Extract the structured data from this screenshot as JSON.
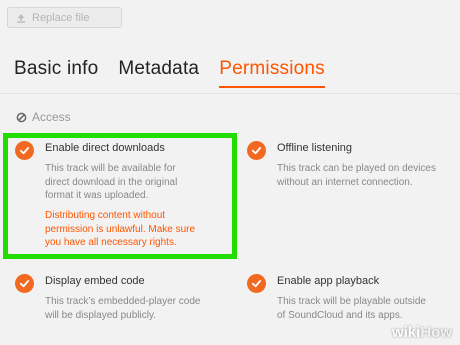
{
  "toolbar": {
    "replace_label": "Replace file"
  },
  "tabs": [
    {
      "label": "Basic info"
    },
    {
      "label": "Metadata"
    },
    {
      "label": "Permissions"
    }
  ],
  "section": {
    "label": "Access"
  },
  "options": [
    {
      "title": "Enable direct downloads",
      "desc": [
        "This track will be available for",
        "direct download in the original",
        "format it was uploaded."
      ],
      "warning": [
        "Distributing content without",
        "permission is unlawful. Make sure",
        "you have all necessary rights."
      ]
    },
    {
      "title": "Offline listening",
      "desc": [
        "This track can be played on devices",
        "without an internet connection."
      ]
    },
    {
      "title": "Display embed code",
      "desc": [
        "This track’s embedded-player code",
        "will be displayed publicly."
      ]
    },
    {
      "title": "Enable app playback",
      "desc": [
        "This track will be playable outside",
        "of SoundCloud and its apps."
      ]
    }
  ],
  "watermark": {
    "wiki": "wiki",
    "how": "How"
  },
  "colors": {
    "accent": "#ff5500",
    "check": "#f26a22",
    "highlight": "#22dd00"
  }
}
